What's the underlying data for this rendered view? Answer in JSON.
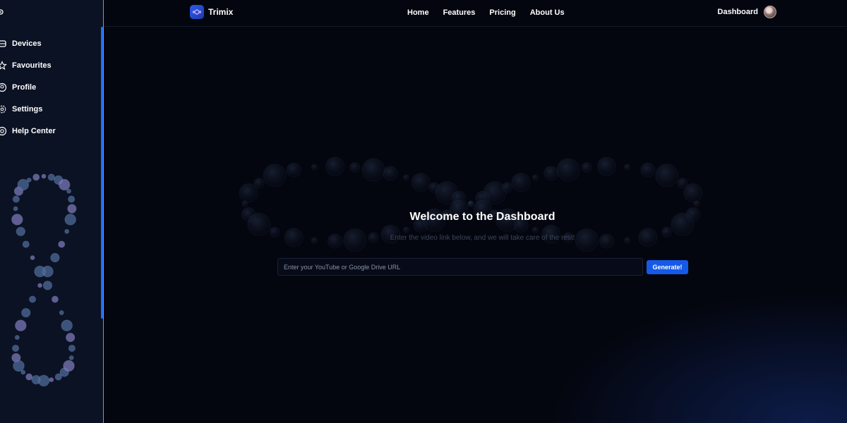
{
  "brand": {
    "name": "Trimix",
    "logo_icon": "infinity-icon",
    "accent": "#2b5cf0"
  },
  "topnav": {
    "links": [
      "Home",
      "Features",
      "Pricing",
      "About Us"
    ],
    "dashboard_label": "Dashboard"
  },
  "sidebar": {
    "items": [
      {
        "label": "Devices",
        "icon": "device-icon"
      },
      {
        "label": "Favourites",
        "icon": "star-icon"
      },
      {
        "label": "Profile",
        "icon": "user-circle-icon"
      },
      {
        "label": "Settings",
        "icon": "gear-icon"
      },
      {
        "label": "Help Center",
        "icon": "help-circle-icon"
      }
    ],
    "scroll_accent": "#1f6ef5"
  },
  "main": {
    "title": "Welcome to the Dashboard",
    "subtitle": "Enter the video link below, and we will take care of the rest!",
    "input_placeholder": "Enter your YouTube or Google Drive URL",
    "input_value": "",
    "generate_label": "Generate!",
    "button_color": "#1559e8"
  }
}
